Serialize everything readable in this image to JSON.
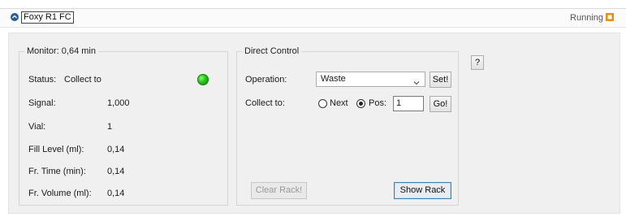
{
  "header": {
    "title": "Foxy R1 FC",
    "status": "Running",
    "collapse_icon": "chevron-up-icon",
    "status_icon": "stop-icon",
    "status_color": "#f08c00"
  },
  "monitor": {
    "legend": "Monitor: 0,64 min",
    "status_label": "Status:",
    "status_value": "Collect to",
    "indicator_color": "#2ec11e",
    "rows": [
      {
        "label": "Signal:",
        "value": "1,000"
      },
      {
        "label": "Vial:",
        "value": "1"
      },
      {
        "label": "Fill Level (ml):",
        "value": "0,14"
      },
      {
        "label": "Fr. Time (min):",
        "value": "0,14"
      },
      {
        "label": "Fr. Volume (ml):",
        "value": "0,14"
      }
    ]
  },
  "direct_control": {
    "legend": "Direct Control",
    "operation_label": "Operation:",
    "operation_value": "Waste",
    "set_button": "Set!",
    "collect_label": "Collect to:",
    "radio_next": "Next",
    "radio_pos": "Pos:",
    "pos_value": "1",
    "go_button": "Go!",
    "clear_rack_button": "Clear Rack!",
    "show_rack_button": "Show Rack"
  },
  "help_button": "?"
}
